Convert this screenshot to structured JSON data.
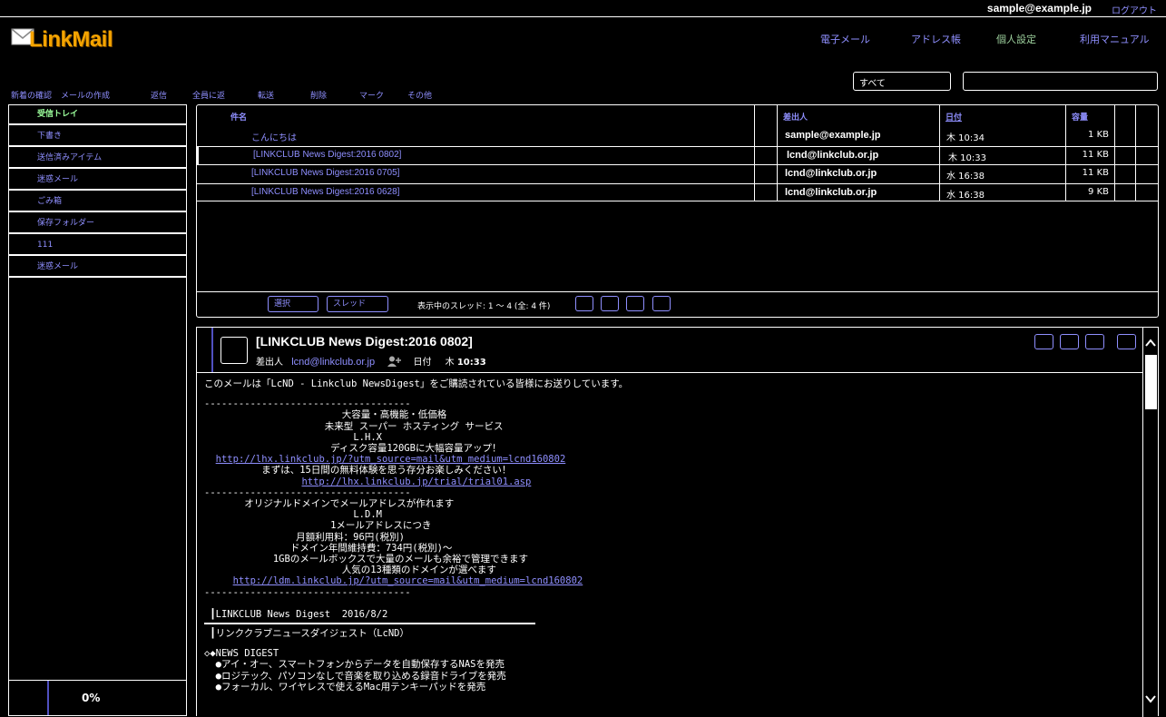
{
  "header": {
    "user_email": "sample@example.jp",
    "logout_label": "ログアウト",
    "app_name": "LinkMail"
  },
  "topnav": [
    "電子メール",
    "アドレス帳",
    "個人設定",
    "利用マニュアル"
  ],
  "search": {
    "filter_value": "すべて",
    "query": ""
  },
  "toolbar": [
    "新着の確認",
    "メールの作成",
    "返信",
    "全員に返",
    "転送",
    "削除",
    "マーク",
    "その他"
  ],
  "folders": [
    "受信トレイ",
    "下書き",
    "送信済みアイテム",
    "迷惑メール",
    "ごみ箱",
    "保存フォルダー",
    "111",
    "迷惑メール"
  ],
  "quota": "0%",
  "list": {
    "columns": {
      "subject": "件名",
      "from": "差出人",
      "date": "日付",
      "size": "容量"
    },
    "rows": [
      {
        "subject": "こんにちは",
        "from": "sample@example.jp",
        "date": "木 10:34",
        "size": "1 KB"
      },
      {
        "subject": "[LINKCLUB News Digest:2016 0802]",
        "from": "lcnd@linkclub.or.jp",
        "date": "木 10:33",
        "size": "11 KB"
      },
      {
        "subject": "[LINKCLUB News Digest:2016 0705]",
        "from": "lcnd@linkclub.or.jp",
        "date": "水 16:38",
        "size": "11 KB"
      },
      {
        "subject": "[LINKCLUB News Digest:2016 0628]",
        "from": "lcnd@linkclub.or.jp",
        "date": "水 16:38",
        "size": "9 KB"
      }
    ],
    "footer": {
      "select_label": "選択",
      "thread_label": "スレッド",
      "thread_info": "表示中のスレッド: 1 〜 4 (全: 4 件)"
    }
  },
  "preview": {
    "subject": "[LINKCLUB News Digest:2016 0802]",
    "from_label": "差出人",
    "from": "lcnd@linkclub.or.jp",
    "date_label": "日付",
    "date_day": "木",
    "date_time": "10:33",
    "body": {
      "intro": "このメールは「LcND - Linkclub NewsDigest」をご購読されている皆様にお送りしています。",
      "dashes1": "------------------------------------",
      "ad1_l1": "                        大容量・高機能・低価格",
      "ad1_l2": "                     未来型 スーパー ホスティング サービス",
      "ad1_l3": "                          L.H.X",
      "ad1_l4": "                      ディスク容量120GBに大幅容量アップ！",
      "ad1_link1_pad": "  ",
      "ad1_link1": "http://lhx.linkclub.jp/?utm_source=mail&utm_medium=lcnd160802",
      "ad1_l5": "",
      "ad1_l6": "          まずは、15日間の無料体験を思う存分お楽しみください！",
      "ad1_link2_pad": "                 ",
      "ad1_link2": "http://lhx.linkclub.jp/trial/trial01.asp",
      "dashes2": "------------------------------------",
      "ad2_l1": "       オリジナルドメインでメールアドレスが作れます",
      "ad2_l2": "                          L.D.M",
      "ad2_l3": "                      1メールアドレスにつき",
      "ad2_l4": "                月額利用料：96円(税別)",
      "ad2_l5": "               ドメイン年間維持費：734円(税別)～",
      "ad2_l6": "",
      "ad2_l7": "            1GBのメールボックスで大量のメールも余裕で管理できます",
      "ad2_l8": "                        人気の13種類のドメインが選べます",
      "ad2_link_pad": "     ",
      "ad2_link": "http://ldm.linkclub.jp/?utm_source=mail&utm_medium=lcnd160802",
      "dashes3": "------------------------------------",
      "h1": " ┃LINKCLUB News Digest  2016/8/2",
      "h2": " ┃リンククラブニュースダイジェスト（LcND）",
      "nd": "◇◆NEWS DIGEST",
      "n1": "  ●アイ・オー、スマートフォンからデータを自動保存するNASを発売",
      "n2": "  ●ロジテック、パソコンなしで音楽を取り込める録音ドライブを発売",
      "n3": "  ●フォーカル、ワイヤレスで使えるMac用テンキーパッドを発売"
    }
  },
  "colors": {
    "background": "#000000",
    "link": "#8f8fff",
    "active_folder": "#9cff9c",
    "logo": "#f5a400"
  }
}
